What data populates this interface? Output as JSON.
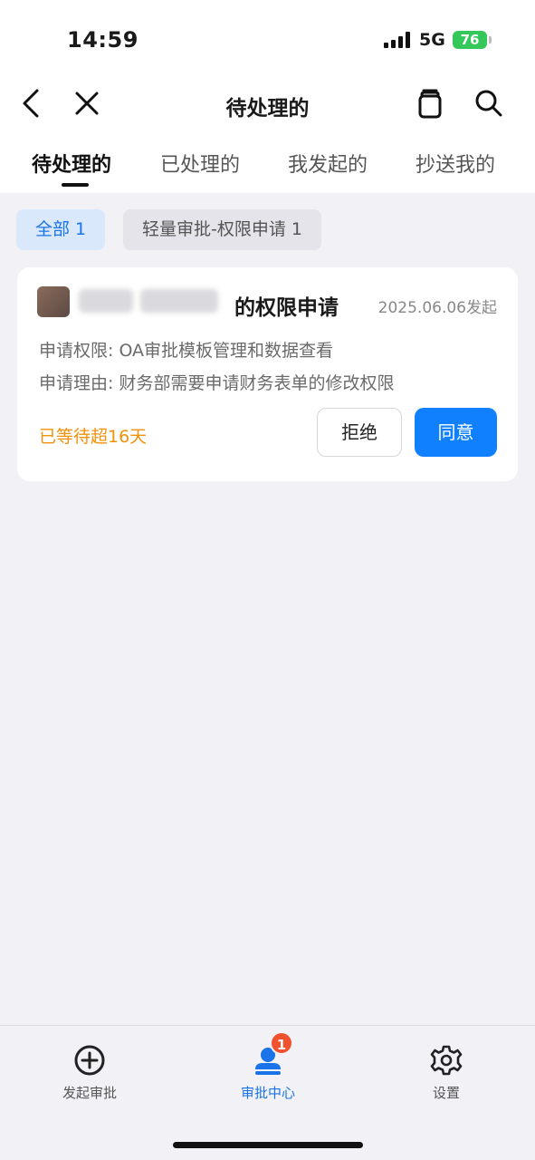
{
  "status_bar": {
    "time": "14:59",
    "network": "5G",
    "battery": "76"
  },
  "nav": {
    "title": "待处理的"
  },
  "tabs": [
    {
      "label": "待处理的",
      "active": true
    },
    {
      "label": "已处理的"
    },
    {
      "label": "我发起的"
    },
    {
      "label": "抄送我的"
    }
  ],
  "filters": [
    {
      "label": "全部 1",
      "selected": true
    },
    {
      "label": "轻量审批-权限申请 1"
    }
  ],
  "card": {
    "title": "的权限申请",
    "date": "2025.06.06发起",
    "line1": "申请权限: OA审批模板管理和数据查看",
    "line2": "申请理由: 财务部需要申请财务表单的修改权限",
    "waiting": "已等待超16天",
    "reject_label": "拒绝",
    "agree_label": "同意"
  },
  "bottom_nav": [
    {
      "label": "发起审批",
      "icon": "add-circle-icon"
    },
    {
      "label": "审批中心",
      "icon": "person-stamp-icon",
      "badge": "1",
      "active": true
    },
    {
      "label": "设置",
      "icon": "gear-icon"
    }
  ],
  "colors": {
    "accent": "#1080ff",
    "warning": "#f0920a",
    "badge": "#f0522e",
    "battery": "#34c759"
  }
}
